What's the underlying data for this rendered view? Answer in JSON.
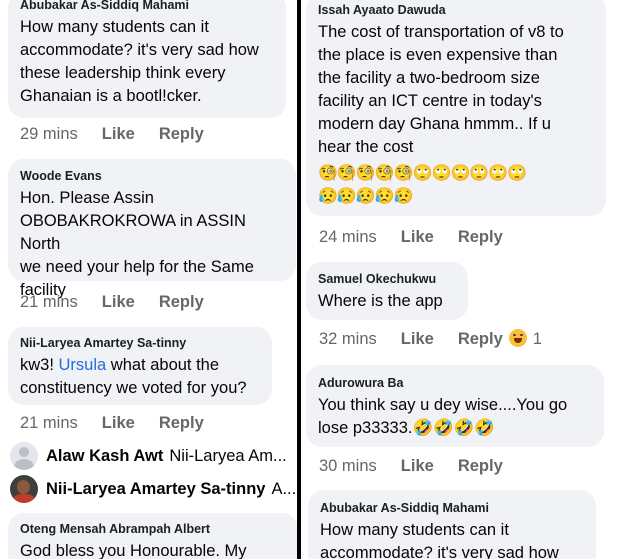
{
  "left": {
    "c1": {
      "author": "Abubakar As-Siddiq Mahami",
      "text": "How many students can it\naccommodate? it's very sad how\nthese leadership think every\nGhanaian is a bootl!cker.",
      "time": "29 mins",
      "like": "Like",
      "reply": "Reply"
    },
    "c2": {
      "author": "Woode Evans",
      "text": "Hon. Please Assin\nOBOBAKROKROWA in ASSIN North\nwe need your help for the Same\nfacility",
      "time": "21 mins",
      "like": "Like",
      "reply": "Reply"
    },
    "c3": {
      "author": "Nii-Laryea Amartey Sa-tinny",
      "text_before": "kw3! ",
      "mention": "Ursula",
      "text_after": "  what about the\nconstituency we voted for you?",
      "time": "21 mins",
      "like": "Like",
      "reply": "Reply"
    },
    "r1": {
      "name": "Alaw Kash Awt",
      "text": "Nii-Laryea Am..."
    },
    "r2": {
      "name": "Nii-Laryea Amartey Sa-tinny",
      "text": "A..."
    },
    "c4": {
      "author": "Oteng Mensah Abrampah Albert",
      "text": "God bless you Honourable. My"
    }
  },
  "right": {
    "c1": {
      "author": "Issah Ayaato Dawuda",
      "text": "The cost of transportation of v8 to\nthe place is even expensive than\nthe facility a two-bedroom size\nfacility an ICT centre in today's\nmodern day Ghana hmmm.. If u\nhear the cost",
      "emoji_line1": "🧐🧐🧐🧐🧐🙄🙄🙄🙄🙄🙄",
      "emoji_line2": "😥😥😥😥😥",
      "time": "24 mins",
      "like": "Like",
      "reply": "Reply"
    },
    "c2": {
      "author": "Samuel Okechukwu",
      "text": "Where is the app",
      "time": "32 mins",
      "like": "Like",
      "reply": "Reply",
      "reaction_count": "1",
      "reaction_icon": "haha-reaction-icon"
    },
    "c3": {
      "author": "Adurowura Ba",
      "text": "You think say u dey wise....You go\nlose p33333.🤣🤣🤣🤣",
      "time": "30 mins",
      "like": "Like",
      "reply": "Reply"
    },
    "c4": {
      "author": "Abubakar As-Siddiq Mahami",
      "text": "How many students can it\naccommodate? it's very sad how"
    }
  }
}
